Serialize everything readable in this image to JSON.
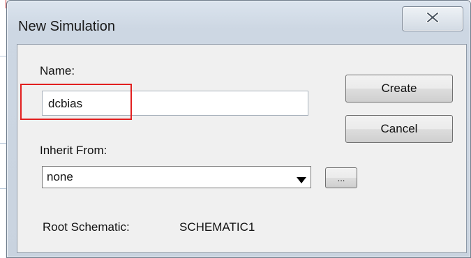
{
  "window": {
    "title": "New Simulation"
  },
  "form": {
    "name_label": "Name:",
    "name_value": "dcbias",
    "inherit_label": "Inherit From:",
    "inherit_selected": "none",
    "browse_label": "...",
    "root_label": "Root Schematic:",
    "root_value": "SCHEMATIC1"
  },
  "buttons": {
    "create": "Create",
    "cancel": "Cancel"
  },
  "icons": {
    "close": "close-icon",
    "dropdown": "chevron-down-icon"
  },
  "colors": {
    "highlight": "#e21f1f",
    "frame": "#cdd7e3"
  }
}
